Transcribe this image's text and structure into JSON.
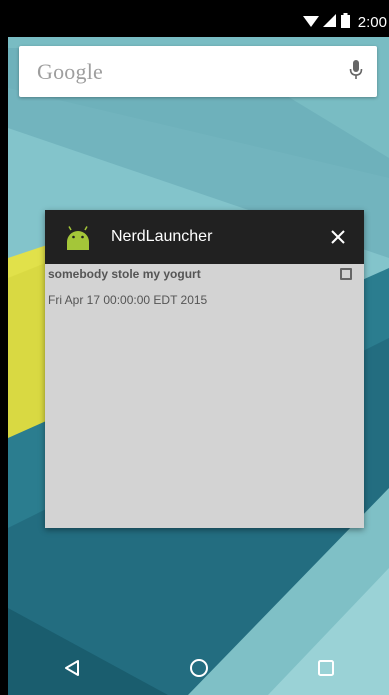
{
  "status_bar": {
    "time": "2:00",
    "icons": [
      "wifi-icon",
      "signal-icon",
      "battery-icon"
    ]
  },
  "search": {
    "logo_text": "Google",
    "mic_icon": "mic-icon"
  },
  "recent_card": {
    "app_icon": "android-icon",
    "app_name": "NerdLauncher",
    "close_icon": "close-icon",
    "item": {
      "title": "somebody stole my yogurt",
      "date": "Fri Apr 17 00:00:00 EDT 2015",
      "checked": false
    }
  },
  "nav_bar": {
    "back_icon": "back-icon",
    "home_icon": "home-icon",
    "recents_icon": "recents-icon"
  },
  "colors": {
    "wallpaper_teal": "#6fb4bd",
    "wallpaper_dark": "#1f6b7f",
    "accent_yellow": "#e1e14a",
    "android_green": "#a4c639"
  }
}
